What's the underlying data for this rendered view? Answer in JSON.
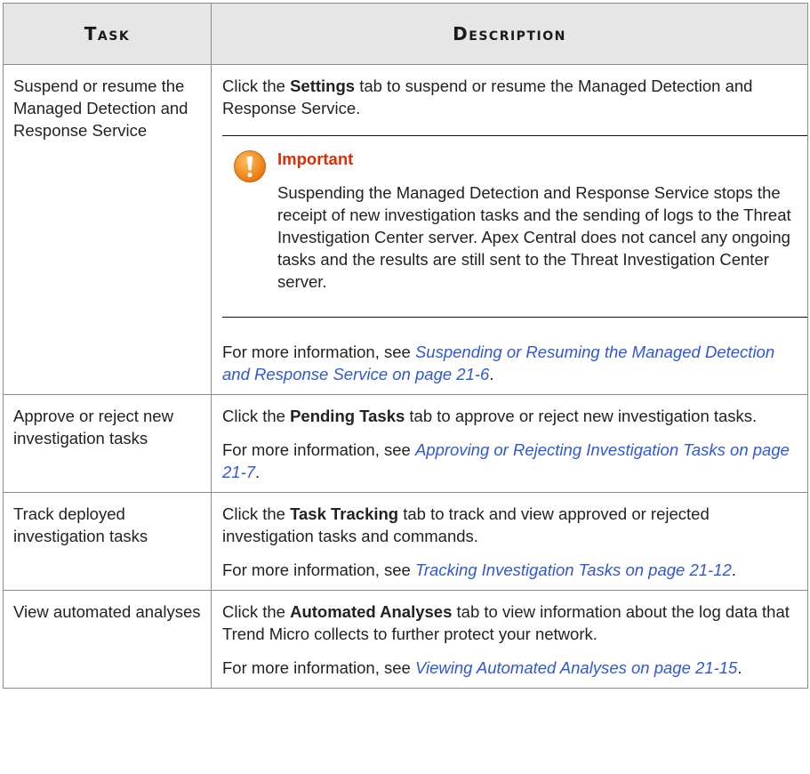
{
  "headers": {
    "task": "Task",
    "description": "Description"
  },
  "rows": [
    {
      "task": "Suspend or resume the Managed Detection and Response Service",
      "desc_before": "Click the ",
      "desc_bold": "Settings",
      "desc_after": " tab to suspend or resume the Managed Detection and Response Service.",
      "note": {
        "title": "Important",
        "text": "Suspending the Managed Detection and Response Service stops the receipt of new investigation tasks and the sending of logs to the Threat Investigation Center server. Apex Central does not cancel any ongoing tasks and the results are still sent to the Threat Investigation Center server.",
        "icon": "warning-icon",
        "icon_color": "#f28c1b"
      },
      "more_prefix": "For more information, see ",
      "more_link": "Suspending or Resuming the Managed Detection and Response Service on page 21-6",
      "more_suffix": "."
    },
    {
      "task": "Approve or reject new investigation tasks",
      "desc_before": "Click the ",
      "desc_bold": "Pending Tasks",
      "desc_after": " tab to approve or reject new investigation tasks.",
      "more_prefix": "For more information, see ",
      "more_link": "Approving or Rejecting Investigation Tasks on page 21-7",
      "more_suffix": "."
    },
    {
      "task": "Track deployed investigation tasks",
      "desc_before": "Click the ",
      "desc_bold": "Task Tracking",
      "desc_after": " tab to track and view approved or rejected investigation tasks and commands.",
      "more_prefix": "For more information, see ",
      "more_link": "Tracking Investigation Tasks on page 21-12",
      "more_suffix": "."
    },
    {
      "task": "View automated analyses",
      "desc_before": "Click the ",
      "desc_bold": "Automated Analyses",
      "desc_after": " tab to view information about the log data that Trend Micro collects to further protect your network.",
      "more_prefix": "For more information, see ",
      "more_link": "Viewing Automated Analyses on page 21-15",
      "more_suffix": "."
    }
  ],
  "colors": {
    "link": "#2f57d8",
    "important": "#e32b00",
    "header_bg": "#e6e6e6"
  }
}
